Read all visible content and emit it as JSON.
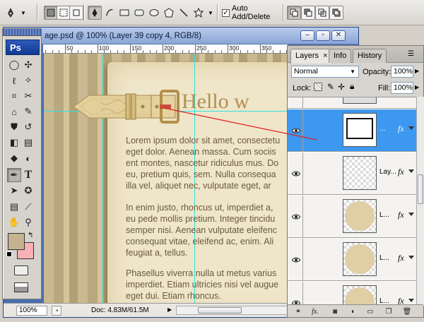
{
  "options_bar": {
    "auto_add_delete_label": "Auto Add/Delete",
    "auto_add_delete_checked": true
  },
  "document": {
    "title": "age.psd @ 100% (Layer 39 copy 4, RGB/8)",
    "ruler_labels": [
      "50",
      "100",
      "150",
      "200",
      "250",
      "300",
      "350"
    ],
    "heading": "Hello w",
    "paragraphs": [
      [
        "Lorem ipsum dolor sit amet, consectetu",
        "eget dolor. Aenean massa. Cum sociis",
        "ent montes, nascetur ridiculus mus. Do",
        "eu, pretium quis, sem. Nulla consequa",
        "illa vel, aliquet nec, vulputate eget, ar"
      ],
      [
        "In enim justo, rhoncus ut, imperdiet a,",
        "eu pede mollis pretium. Integer tincidu",
        "semper nisi. Aenean vulputate eleifenc",
        "consequat vitae, eleifend ac, enim. Ali",
        "feugiat a, tellus."
      ],
      [
        "Phasellus viverra nulla ut metus varius",
        "imperdiet. Etiam ultricies nisi vel augue",
        "eget dui. Etiam rhoncus."
      ]
    ],
    "zoom": "100%",
    "doc_info": "Doc: 4.83M/61.5M"
  },
  "toolbox": {
    "logo": "Ps",
    "text_tool_glyph": "T",
    "foreground_color": "#c4b38e",
    "background_color": "#f8b2b6"
  },
  "panel": {
    "tabs": [
      {
        "label": "Layers",
        "close": "×",
        "active": true
      },
      {
        "label": "Info",
        "active": false
      },
      {
        "label": "History",
        "active": false
      }
    ],
    "blend_mode": "Normal",
    "opacity_label": "Opacity:",
    "opacity": "100%",
    "lock_label": "Lock:",
    "fill_label": "Fill:",
    "fill": "100%",
    "layers": [
      {
        "name": "",
        "type": "top",
        "selected": false
      },
      {
        "name": "...",
        "type": "rect",
        "selected": true
      },
      {
        "name": "Lay...",
        "type": "empty",
        "selected": false
      },
      {
        "name": "L...",
        "type": "circle",
        "selected": false
      },
      {
        "name": "L...",
        "type": "circle",
        "selected": false
      },
      {
        "name": "L...",
        "type": "circle",
        "selected": false
      }
    ],
    "fx_label": "fx",
    "bottom_fx": "fx."
  },
  "colors": {
    "selection_blue": "#3d98f0",
    "guide_cyan": "#2fe3e3",
    "pointer_red": "#e02020"
  }
}
